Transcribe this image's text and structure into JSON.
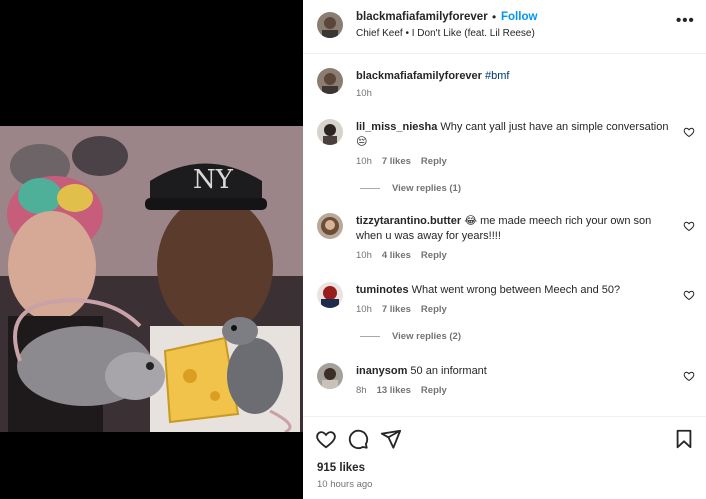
{
  "post": {
    "username": "blackmafiafamilyforever",
    "dot": "•",
    "follow_label": "Follow",
    "audio": "Chief Keef • I Don't Like (feat. Lil Reese)",
    "more_label": "•••"
  },
  "caption": {
    "username": "blackmafiafamilyforever",
    "text": "#bmf",
    "time": "10h"
  },
  "comments": [
    {
      "username": "lil_miss_niesha",
      "text": "Why cant yall just have an simple conversation 😔",
      "time": "10h",
      "likes": "7 likes",
      "reply": "Reply",
      "view_replies": "View replies (1)"
    },
    {
      "username": "tizzytarantino.butter",
      "text": "😂 me made meech rich your own son when u was away for years!!!!",
      "time": "10h",
      "likes": "4 likes",
      "reply": "Reply"
    },
    {
      "username": "tuminotes",
      "text": "What went wrong between Meech and 50?",
      "time": "10h",
      "likes": "7 likes",
      "reply": "Reply",
      "view_replies": "View replies (2)"
    },
    {
      "username": "inanysom",
      "text": "50 an informant",
      "time": "8h",
      "likes": "13 likes",
      "reply": "Reply"
    }
  ],
  "footer": {
    "likes": "915 likes",
    "posted": "10 hours ago"
  },
  "colors": {
    "link": "#0095f6",
    "muted": "#737373",
    "hashtag": "#00376b"
  }
}
